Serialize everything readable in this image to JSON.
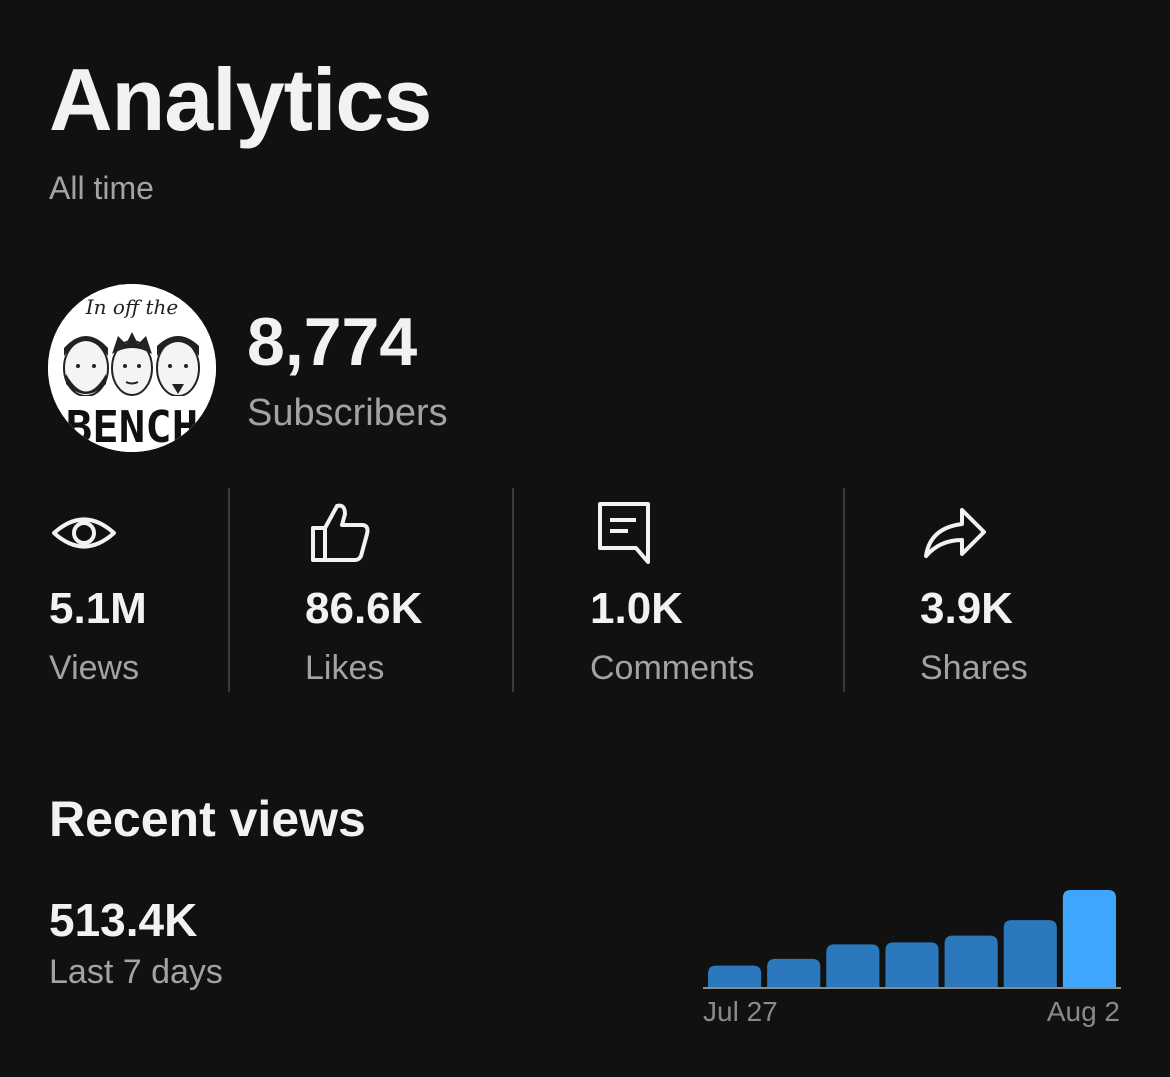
{
  "header": {
    "title": "Analytics",
    "period": "All time"
  },
  "channel": {
    "avatar_text_top": "In off the",
    "avatar_text_bottom": "BENCH",
    "subscribers_count": "8,774",
    "subscribers_label": "Subscribers"
  },
  "stats": [
    {
      "icon": "eye-icon",
      "value": "5.1M",
      "label": "Views"
    },
    {
      "icon": "thumbs-up-icon",
      "value": "86.6K",
      "label": "Likes"
    },
    {
      "icon": "comment-icon",
      "value": "1.0K",
      "label": "Comments"
    },
    {
      "icon": "share-icon",
      "value": "3.9K",
      "label": "Shares"
    }
  ],
  "recent": {
    "title": "Recent views",
    "value": "513.4K",
    "period": "Last 7 days"
  },
  "chart_data": {
    "type": "bar",
    "categories": [
      "",
      "",
      "",
      "",
      "",
      "",
      ""
    ],
    "values": [
      22,
      29,
      44,
      46,
      53,
      69,
      100
    ],
    "x_tick_labels": [
      "Jul 27",
      "Aug 2"
    ],
    "colors": {
      "bar": "#2c78bc",
      "highlight": "#3ea6ff",
      "baseline": "#8a8a8a",
      "tick_text": "#8a8a8a"
    }
  }
}
